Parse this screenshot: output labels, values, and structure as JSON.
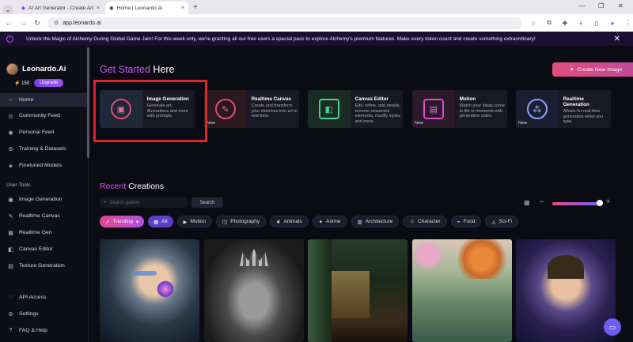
{
  "browser": {
    "tabs": [
      {
        "title": "AI Art Generator - Create Art",
        "active": false
      },
      {
        "title": "Home | Leonardo.Ai",
        "active": true
      }
    ],
    "url": "app.leonardo.ai"
  },
  "banner": {
    "text": "Unlock the Magic of Alchemy During Global Game Jam! For this week only, we're granting all our free users a special pass to explore Alchemy's premium features. Make every token count and create something extraordinary!"
  },
  "sidebar": {
    "brand": "Leonardo.Ai",
    "tokens": "150",
    "upgrade": "Upgrade",
    "items": [
      {
        "label": "Home",
        "icon": "home-icon"
      },
      {
        "label": "Community Feed",
        "icon": "community-icon"
      },
      {
        "label": "Personal Feed",
        "icon": "personal-icon"
      },
      {
        "label": "Training & Datasets",
        "icon": "training-icon"
      },
      {
        "label": "Finetuned Models",
        "icon": "models-icon"
      }
    ],
    "tools_label": "User Tools",
    "tools": [
      {
        "label": "Image Generation"
      },
      {
        "label": "Realtime Canvas"
      },
      {
        "label": "Realtime Gen"
      },
      {
        "label": "Canvas Editor"
      },
      {
        "label": "Texture Generation"
      }
    ],
    "bottom": [
      {
        "label": "API Access"
      },
      {
        "label": "Settings"
      },
      {
        "label": "FAQ & Help"
      }
    ]
  },
  "main": {
    "get_started_accent": "Get Started",
    "get_started_rest": " Here",
    "create_button": "Create New Image",
    "cards": [
      {
        "title": "Image Generation",
        "desc": "Generate art, illustrations and more with prompts.",
        "new": ""
      },
      {
        "title": "Realtime Canvas",
        "desc": "Create and transform your sketches into art in real-time.",
        "new": "New"
      },
      {
        "title": "Canvas Editor",
        "desc": "Edit, refine, add details, remove unwanted elements, modify styles and more.",
        "new": ""
      },
      {
        "title": "Motion",
        "desc": "Watch your ideas come to life in moments with generative video.",
        "new": "New"
      },
      {
        "title": "Realtime Generation",
        "desc": "Allows for real-time generation while you type.",
        "new": "New"
      }
    ],
    "recent_accent": "Recent",
    "recent_rest": " Creations",
    "search_placeholder": "Search gallery",
    "search_button": "Search",
    "filters": [
      "Trending",
      "All",
      "Motion",
      "Photography",
      "Animals",
      "Anime",
      "Architecture",
      "Character",
      "Food",
      "Sci-Fi"
    ]
  },
  "colors": {
    "accent": "#c55be8",
    "highlight_box": "#e02428",
    "bg": "#0b0b14"
  }
}
